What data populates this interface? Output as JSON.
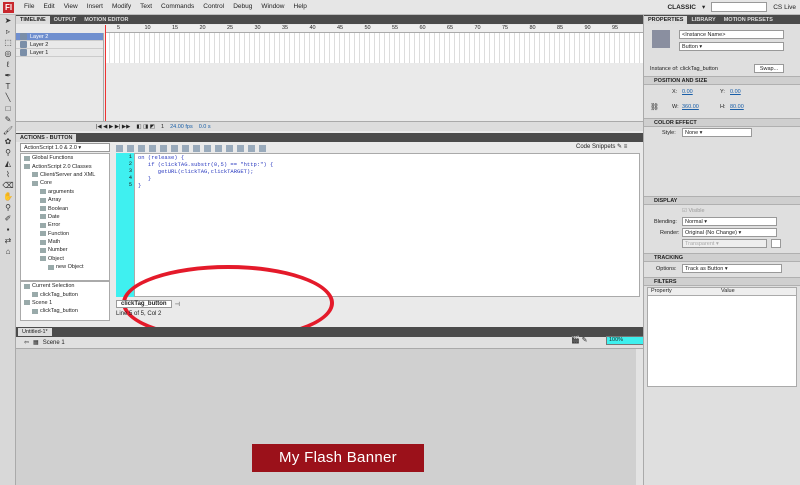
{
  "app": {
    "logo": "Fl",
    "workspace": "CLASSIC",
    "cslive": "CS Live"
  },
  "menu": [
    "File",
    "Edit",
    "View",
    "Insert",
    "Modify",
    "Text",
    "Commands",
    "Control",
    "Debug",
    "Window",
    "Help"
  ],
  "timeline": {
    "tabs": [
      "TIMELINE",
      "OUTPUT",
      "MOTION EDITOR"
    ],
    "layers": [
      {
        "name": "Layer 2",
        "selected": true
      },
      {
        "name": "Layer 2",
        "selected": false
      },
      {
        "name": "Layer 1",
        "selected": false
      }
    ],
    "ruler": [
      "5",
      "10",
      "15",
      "20",
      "25",
      "30",
      "35",
      "40",
      "45",
      "50",
      "55",
      "60",
      "65",
      "70",
      "75",
      "80",
      "85",
      "90",
      "95"
    ],
    "frame": "1",
    "fps": "24.00 fps",
    "time": "0.0 s"
  },
  "actions": {
    "tab": "ACTIONS - BUTTON",
    "version": "ActionScript 1.0 & 2.0",
    "tree": [
      {
        "label": "Global Functions",
        "indent": 0
      },
      {
        "label": "ActionScript 2.0 Classes",
        "indent": 0
      },
      {
        "label": "Client/Server and XML",
        "indent": 1
      },
      {
        "label": "Core",
        "indent": 1
      },
      {
        "label": "arguments",
        "indent": 2
      },
      {
        "label": "Array",
        "indent": 2
      },
      {
        "label": "Boolean",
        "indent": 2
      },
      {
        "label": "Date",
        "indent": 2
      },
      {
        "label": "Error",
        "indent": 2
      },
      {
        "label": "Function",
        "indent": 2
      },
      {
        "label": "Math",
        "indent": 2
      },
      {
        "label": "Number",
        "indent": 2
      },
      {
        "label": "Object",
        "indent": 2
      },
      {
        "label": "new Object",
        "indent": 3
      }
    ],
    "tree2": [
      {
        "label": "Current Selection",
        "indent": 0
      },
      {
        "label": "clickTag_button",
        "indent": 1
      },
      {
        "label": "Scene 1",
        "indent": 0
      },
      {
        "label": "clickTag_button",
        "indent": 1
      }
    ],
    "snippets": "Code Snippets",
    "line_numbers": [
      "1",
      "2",
      "3",
      "4",
      "5"
    ],
    "code": [
      "on (release) {",
      "   if (clickTAG.substr(0,5) == \"http:\") {",
      "      getURL(clickTAG,clickTARGET);",
      "   }",
      "}"
    ],
    "code_tab": "clickTag_button",
    "status": "Line 5 of 5, Col 2"
  },
  "document": {
    "tab": "Untitled-1*",
    "scene": "Scene 1",
    "zoom": "100%",
    "banner_text": "My Flash Banner",
    "banner_color": "#9b111a"
  },
  "properties": {
    "tabs": [
      "PROPERTIES",
      "LIBRARY",
      "MOTION PRESETS"
    ],
    "instance_placeholder": "<Instance Name>",
    "type": "Button",
    "instance_of_label": "Instance of:",
    "instance_of": "clickTag_button",
    "swap": "Swap...",
    "pos_size": "POSITION AND SIZE",
    "x_label": "X:",
    "x": "0.00",
    "y_label": "Y:",
    "y": "0.00",
    "w_label": "W:",
    "w": "360.00",
    "h_label": "H:",
    "h": "80.00",
    "color_effect": "COLOR EFFECT",
    "style_label": "Style:",
    "style": "None",
    "display": "DISPLAY",
    "visible": "Visible",
    "blending_label": "Blending:",
    "blending": "Normal",
    "render_label": "Render:",
    "render": "Original (No Change)",
    "transparent": "Transparent",
    "tracking": "TRACKING",
    "options_label": "Options:",
    "options": "Track as Button",
    "filters": "FILTERS",
    "filter_cols": [
      "Property",
      "Value"
    ]
  },
  "colors": {
    "accent": "#3ff0f0",
    "highlight": "#e41a2a",
    "selection": "#6f8fcf"
  }
}
